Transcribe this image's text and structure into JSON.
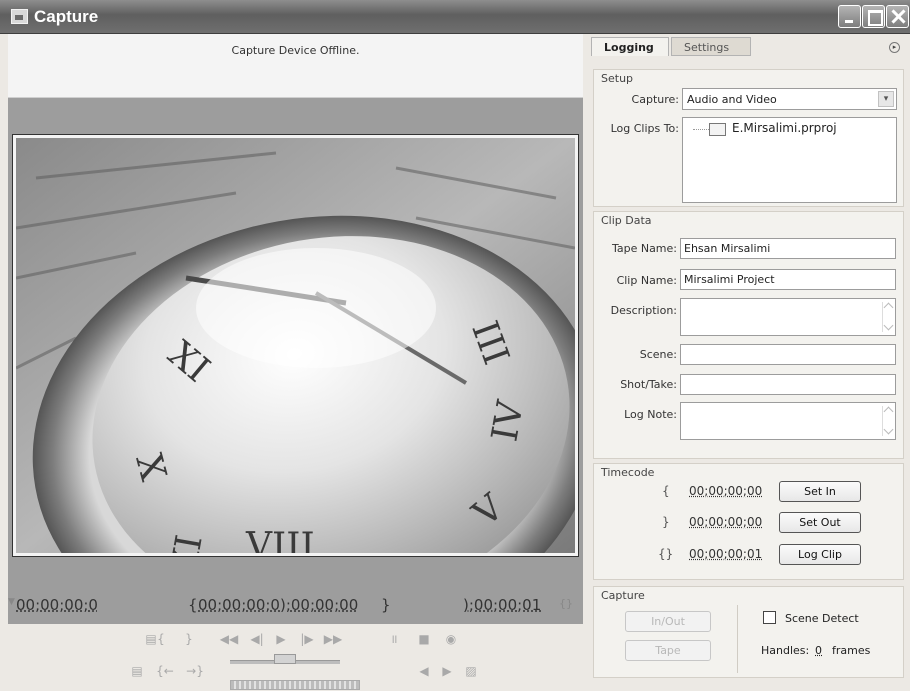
{
  "window": {
    "title": "Capture"
  },
  "monitor": {
    "status": "Capture Device Offline.",
    "current_tc": "00;00;00;0",
    "in_out_tc": "00;00;00;0);00;00;00",
    "duration_tc": ");00;00;01"
  },
  "tabs": [
    {
      "label": "Logging"
    },
    {
      "label": "Settings"
    }
  ],
  "setup": {
    "group_label": "Setup",
    "capture_label": "Capture:",
    "capture_value": "Audio and Video",
    "log_clips_label": "Log Clips To:",
    "log_clips_item": "E.Mirsalimi.prproj"
  },
  "clip_data": {
    "group_label": "Clip Data",
    "tape_name_label": "Tape Name:",
    "tape_name_value": "Ehsan Mirsalimi",
    "clip_name_label": "Clip Name:",
    "clip_name_value": "Mirsalimi Project",
    "description_label": "Description:",
    "description_value": "",
    "scene_label": "Scene:",
    "scene_value": "",
    "shot_take_label": "Shot/Take:",
    "shot_take_value": "",
    "log_note_label": "Log Note:",
    "log_note_value": ""
  },
  "timecode": {
    "group_label": "Timecode",
    "in_tc": "00;00;00;00",
    "out_tc": "00;00;00;00",
    "duration_tc": "00;00;00;01",
    "set_in_label": "Set In",
    "set_out_label": "Set Out",
    "log_clip_label": "Log Clip"
  },
  "capture": {
    "group_label": "Capture",
    "in_out_label": "In/Out",
    "tape_label": "Tape",
    "scene_detect_label": "Scene Detect",
    "handles_label": "Handles:",
    "handles_value": "0",
    "frames_label": "frames"
  },
  "icons": {
    "in_point": "{",
    "out_point": "}",
    "duration": "{}",
    "flyout": "▸",
    "dropdown": "▾"
  },
  "colors": {
    "titlebar": "#6f6f6f",
    "monitor_bg": "#9d9d9d",
    "panel_bg": "#f3f2ee"
  }
}
